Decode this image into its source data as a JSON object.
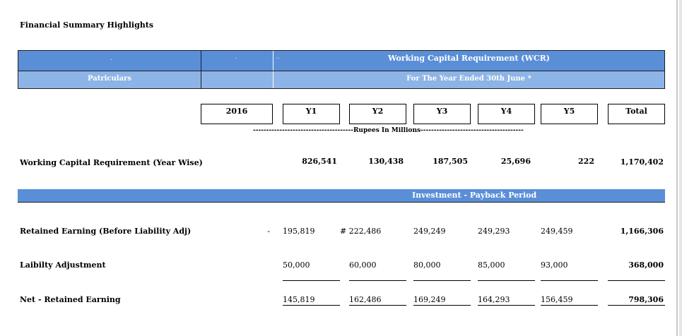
{
  "title": "Financial Summary Highlights",
  "wcr_header": {
    "heading": "Working Capital Requirement (WCR)",
    "particulars": "Patriculars",
    "period": "For The Year Ended 30th June *",
    "dot1": ".",
    "dot2": ".",
    "dot3": ".."
  },
  "years": [
    "2016",
    "Y1",
    "Y2",
    "Y3",
    "Y4",
    "Y5",
    "Total"
  ],
  "unit_note": "--------------------------------------Rupees In Millions---------------------------------------",
  "wcr_row": {
    "label": "Working Capital Requirement (Year Wise)",
    "values": [
      "826,541",
      "130,438",
      "187,505",
      "25,696",
      "222",
      "1,170,402"
    ]
  },
  "investment_header": "Investment - Payback Period",
  "retained_row": {
    "label": "Retained Earning (Before Liability Adj)",
    "base": "-",
    "values": [
      "195,819",
      "# 222,486",
      "249,249",
      "249,293",
      "249,459",
      "1,166,306"
    ]
  },
  "liability_row": {
    "label": "Laibilty Adjustment",
    "values": [
      "50,000",
      "60,000",
      "80,000",
      "85,000",
      "93,000",
      "368,000"
    ]
  },
  "net_row": {
    "label": "Net - Retained Earning",
    "values": [
      "145,819",
      "162,486",
      "169,249",
      "164,293",
      "156,459",
      "798,306"
    ]
  }
}
